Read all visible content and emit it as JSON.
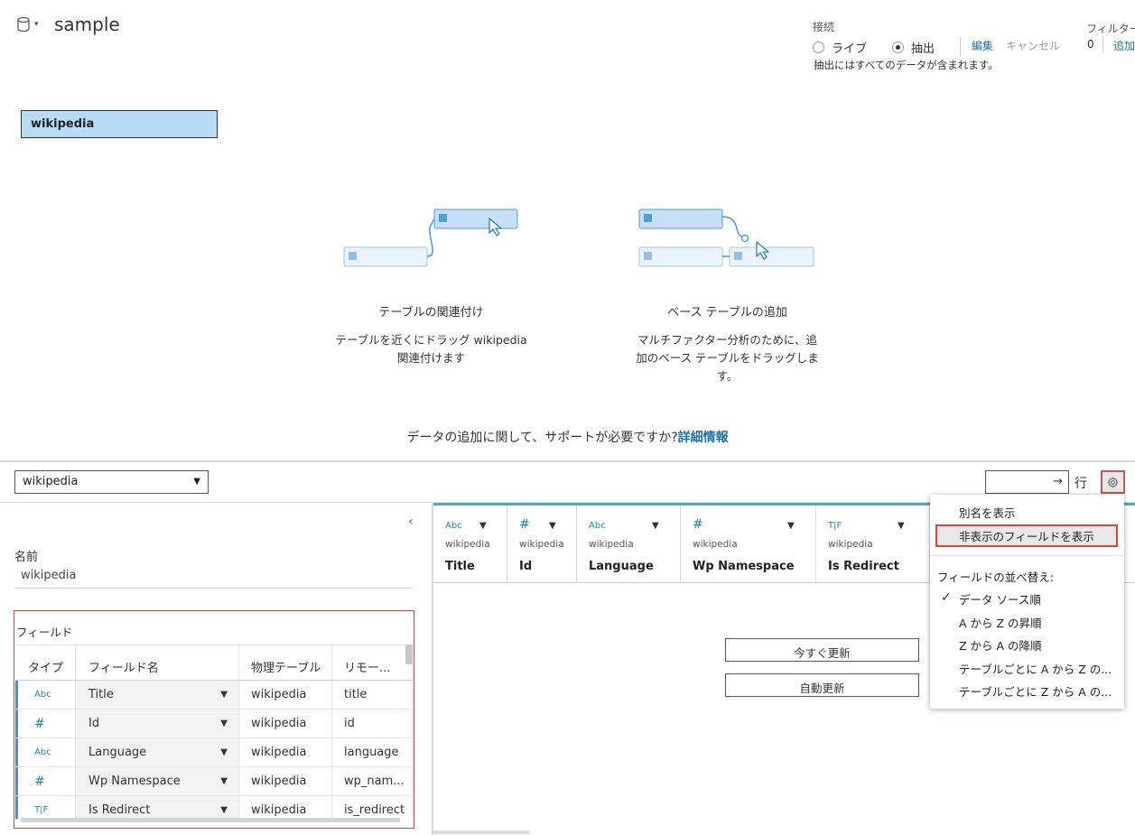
{
  "header": {
    "datasource_icon": "database-icon",
    "title": "sample",
    "connection_label": "接続",
    "live_label": "ライブ",
    "extract_label": "抽出",
    "edit_label": "編集",
    "cancel_label": "キャンセル",
    "extract_note": "抽出にはすべてのデータが含まれます。",
    "filter_label": "フィルター",
    "filter_count": "0",
    "filter_add": "追加"
  },
  "canvas": {
    "table_chip": "wikipedia",
    "relate": {
      "title": "テーブルの関連付け",
      "desc_line1": "テーブルを近くにドラッグ wikipedia",
      "desc_line2": "関連付けます"
    },
    "base": {
      "title": "ベース テーブルの追加",
      "desc_line1": "マルチファクター分析のために、追",
      "desc_line2": "加のベース テーブルをドラッグしま",
      "desc_line3": "す。"
    },
    "help_text": "データの追加に関して、サポートが必要ですか?",
    "help_link": "詳細情報"
  },
  "toolbar": {
    "table_select": "wikipedia",
    "rows_arrow": "→",
    "rows_label": "行",
    "gear_icon": "gear-icon"
  },
  "left_panel": {
    "name_label": "名前",
    "name_value": "wikipedia",
    "fields_title": "フィールド",
    "columns": [
      "タイプ",
      "フィールド名",
      "物理テーブル",
      "リモー..."
    ],
    "rows": [
      {
        "type": "Abc",
        "name": "Title",
        "table": "wikipedia",
        "remote": "title"
      },
      {
        "type": "#",
        "name": "Id",
        "table": "wikipedia",
        "remote": "id"
      },
      {
        "type": "Abc",
        "name": "Language",
        "table": "wikipedia",
        "remote": "language"
      },
      {
        "type": "#",
        "name": "Wp Namespace",
        "table": "wikipedia",
        "remote": "wp_nam..."
      },
      {
        "type": "T|F",
        "name": "Is Redirect",
        "table": "wikipedia",
        "remote": "is_redirect"
      }
    ]
  },
  "grid": {
    "columns": [
      {
        "type": "Abc",
        "source": "wikipedia",
        "name": "Title"
      },
      {
        "type": "#",
        "source": "wikipedia",
        "name": "Id"
      },
      {
        "type": "Abc",
        "source": "wikipedia",
        "name": "Language"
      },
      {
        "type": "#",
        "source": "wikipedia",
        "name": "Wp Namespace"
      },
      {
        "type": "T|F",
        "source": "wikipedia",
        "name": "Is Redirect"
      }
    ],
    "refresh_now": "今すぐ更新",
    "auto_refresh": "自動更新"
  },
  "menu": {
    "show_aliases": "別名を表示",
    "show_hidden": "非表示のフィールドを表示",
    "sort_heading": "フィールドの並べ替え:",
    "sort_options": [
      "データ ソース順",
      "A から Z の昇順",
      "Z から A の降順",
      "テーブルごとに A から Z の...",
      "テーブルごとに Z から A の..."
    ],
    "checked_mark": "✓"
  },
  "colors": {
    "accent": "#1a73a8",
    "highlight_border": "#e0413c",
    "table_chip_bg": "#b9dcf5"
  }
}
